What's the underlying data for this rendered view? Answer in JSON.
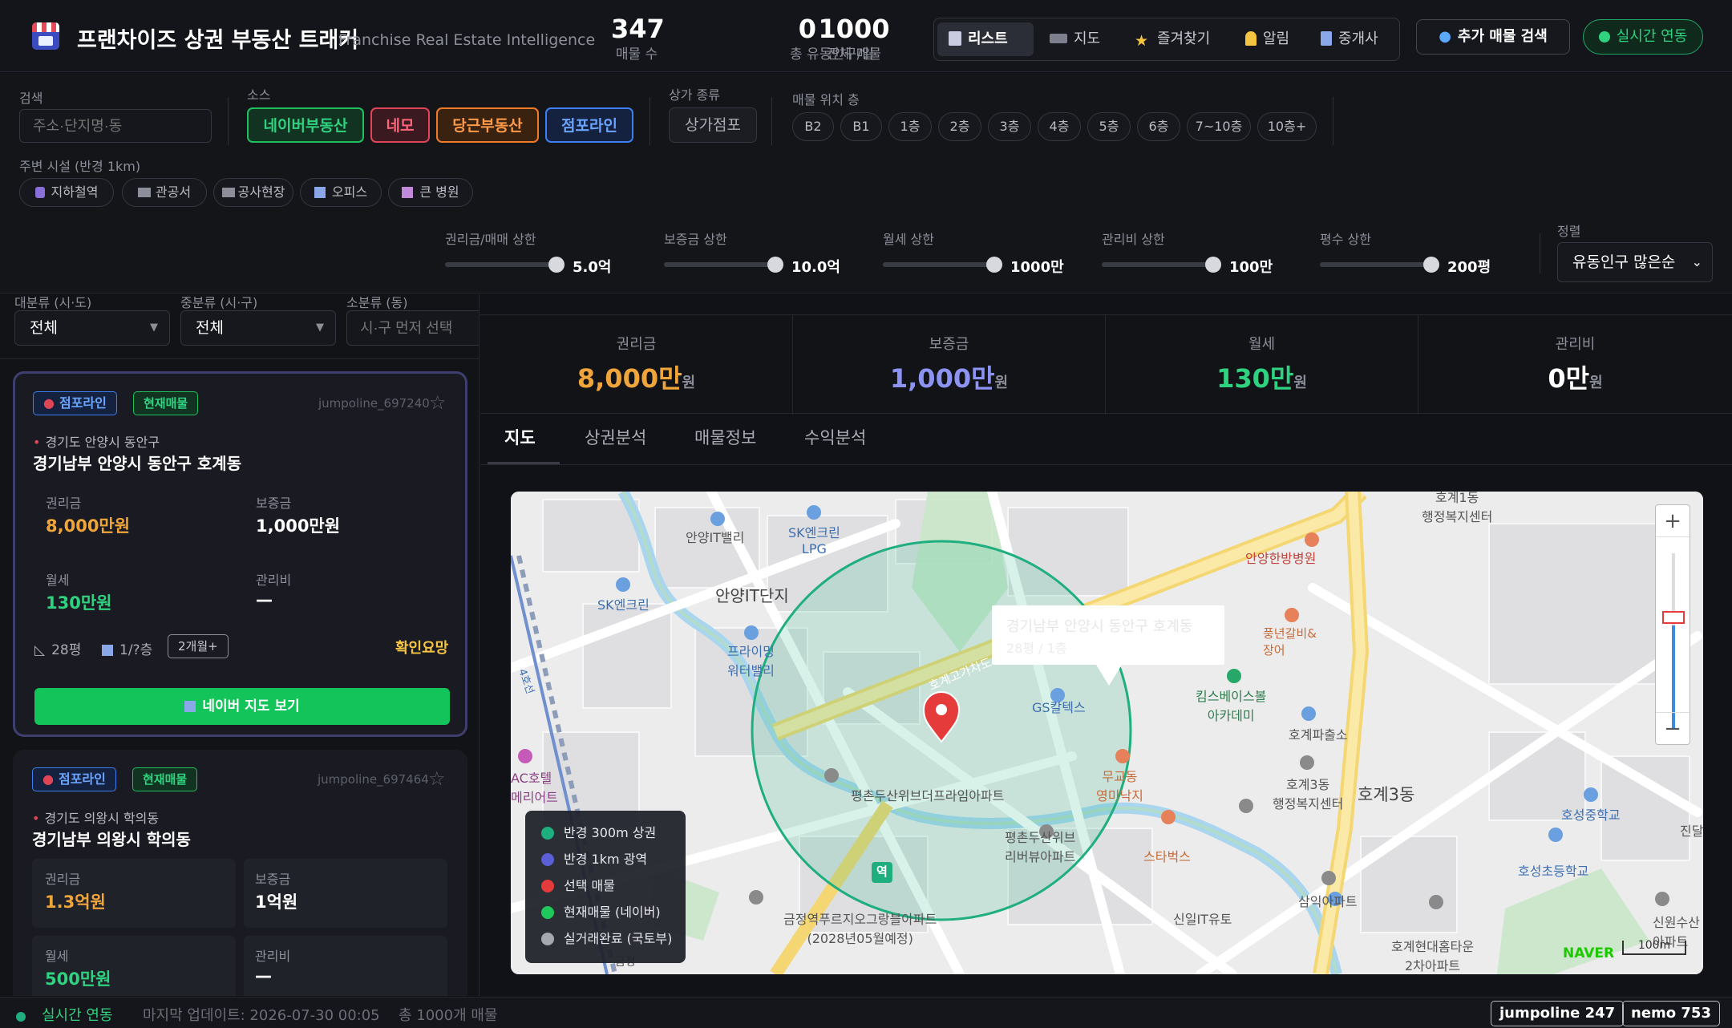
{
  "header": {
    "title": "프랜차이즈 상권 부동산 트래커",
    "subtitle": "Franchise Real Estate Intelligence",
    "stats": [
      {
        "value": "347",
        "label": "매물 수"
      },
      {
        "value": "0",
        "label": "총 유동인구/일"
      },
      {
        "value": "1000",
        "label": "전체 매물"
      }
    ],
    "nav": [
      {
        "label": "리스트",
        "icon": "clipboard-icon",
        "active": true
      },
      {
        "label": "지도",
        "icon": "map-icon"
      },
      {
        "label": "즐겨찾기",
        "icon": "star-icon"
      },
      {
        "label": "알림",
        "icon": "bell-icon"
      },
      {
        "label": "중개사",
        "icon": "building-icon"
      }
    ],
    "search_button": "추가 매물 검색",
    "live_button": "실시간 연동"
  },
  "filters": {
    "search_label": "검색",
    "search_placeholder": "주소·단지명·동",
    "source_label": "소스",
    "sources": [
      "네이버부동산",
      "네모",
      "당근부동산",
      "점포라인"
    ],
    "type_label": "상가 종류",
    "type_value": "상가점포",
    "floor_label": "매물 위치 층",
    "floors": [
      "B2",
      "B1",
      "1층",
      "2층",
      "3층",
      "4층",
      "5층",
      "6층",
      "7~10층",
      "10층+"
    ],
    "nearby_label": "주변 시설 (반경 1km)",
    "nearby": [
      {
        "label": "지하철역",
        "icon": "subway-icon"
      },
      {
        "label": "관공서",
        "icon": "government-icon"
      },
      {
        "label": "공사현장",
        "icon": "construction-icon"
      },
      {
        "label": "오피스",
        "icon": "office-icon"
      },
      {
        "label": "큰 병원",
        "icon": "hospital-icon"
      }
    ],
    "sliders": [
      {
        "label": "권리금/매매 상한",
        "value": "5.0억"
      },
      {
        "label": "보증금 상한",
        "value": "10.0억"
      },
      {
        "label": "월세 상한",
        "value": "1000만"
      },
      {
        "label": "관리비 상한",
        "value": "100만"
      },
      {
        "label": "평수 상한",
        "value": "200평"
      }
    ],
    "sort_label": "정렬",
    "sort_value": "유동인구 많은순"
  },
  "region": {
    "major_label": "대분류 (시·도)",
    "major_value": "전체",
    "mid_label": "중분류 (시·구)",
    "mid_value": "전체",
    "minor_label": "소분류 (동)",
    "minor_placeholder": "시·구 먼저 선택"
  },
  "listings": [
    {
      "source": "점포라인",
      "status": "현재매물",
      "id": "jumpoline_697240",
      "region": "경기도 안양시 동안구",
      "address": "경기남부 안양시 동안구 호계동",
      "premium_label": "권리금",
      "premium": "8,000만원",
      "deposit_label": "보증금",
      "deposit": "1,000만원",
      "rent_label": "월세",
      "rent": "130만원",
      "mgmt_label": "관리비",
      "mgmt": "—",
      "area": "28평",
      "floor": "1/?층",
      "age": "2개월+",
      "check": "확인요망",
      "map_button": "네이버 지도 보기"
    },
    {
      "source": "점포라인",
      "status": "현재매물",
      "id": "jumpoline_697464",
      "region": "경기도 의왕시 학의동",
      "address": "경기남부 의왕시 학의동",
      "premium_label": "권리금",
      "premium": "1.3억원",
      "deposit_label": "보증금",
      "deposit": "1억원",
      "rent_label": "월세",
      "rent": "500만원",
      "mgmt_label": "관리비",
      "mgmt": "—"
    }
  ],
  "summary": [
    {
      "label": "권리금",
      "value": "8,000만",
      "unit": "원",
      "color": "#f0a53a"
    },
    {
      "label": "보증금",
      "value": "1,000만",
      "unit": "원",
      "color": "#8d93f3"
    },
    {
      "label": "월세",
      "value": "130만",
      "unit": "원",
      "color": "#2fd27f"
    },
    {
      "label": "관리비",
      "value": "0만",
      "unit": "원",
      "color": "#ffffff"
    }
  ],
  "tabs": [
    "지도",
    "상권분석",
    "매물정보",
    "수익분석"
  ],
  "map": {
    "popup_title": "경기남부 안양시 동안구 호계동",
    "popup_sub": "28평 / 1층",
    "legend": [
      {
        "label": "반경 300m 상권",
        "color": "#1fae7e"
      },
      {
        "label": "반경 1km 광역",
        "color": "#5a5fd6"
      },
      {
        "label": "선택 매물",
        "color": "#e63b3b"
      },
      {
        "label": "현재매물 (네이버)",
        "color": "#1ec85a"
      },
      {
        "label": "실거래완료 (국토부)",
        "color": "#a6a8b0"
      }
    ],
    "labels": {
      "anyang_it_valley": "안양IT밸리",
      "sk_lpg": "SK엔크린\nLPG",
      "anyang_it_complex": "안양IT단지",
      "sk_encrin": "SK엔크린",
      "priming": "프라이밍\n워터밸리",
      "hogye_road": "호계고가차도",
      "gs_caltex": "GS칼텍스",
      "kids": "킴스베이스볼\n아카데미",
      "anyang_hospital": "안양한방병원",
      "galbi": "풍년갈비&\n장어",
      "hogye1": "호계1동\n행정복지센터",
      "police": "호계파출소",
      "hogye3_center": "호계3동\n행정복지센터",
      "hogye3": "호계3동",
      "apt1": "평촌두산위브더프라임아파트",
      "apt2": "평촌두산위브\n리버뷰아파트",
      "mugyo": "무교동\n영미낙지",
      "starbucks": "스타벅스",
      "hoseong_mid": "호성중학교",
      "hoseong_ele": "호성초등학교",
      "samik": "삼익아파트",
      "sinil": "신일IT유토",
      "geumjeong": "금정역푸르지오그랑블아파트\n(2028년05월예정)",
      "hyundai": "호계현대홈타운\n2차아파트",
      "sinwon": "신원수산\n아파트",
      "ac_hotel": "AC호텔\n메리어트",
      "line4": "4호선",
      "station": "역",
      "geumjeong_ic": "금정",
      "jindal": "진달"
    },
    "brand": "NAVER",
    "scale": "100m"
  },
  "status": {
    "live": "실시간 연동",
    "updated": "마지막 업데이트: 2026-07-30 00:05",
    "total": "총 1000개 매물",
    "sources": [
      "jumpoline 247",
      "nemo 753"
    ]
  }
}
